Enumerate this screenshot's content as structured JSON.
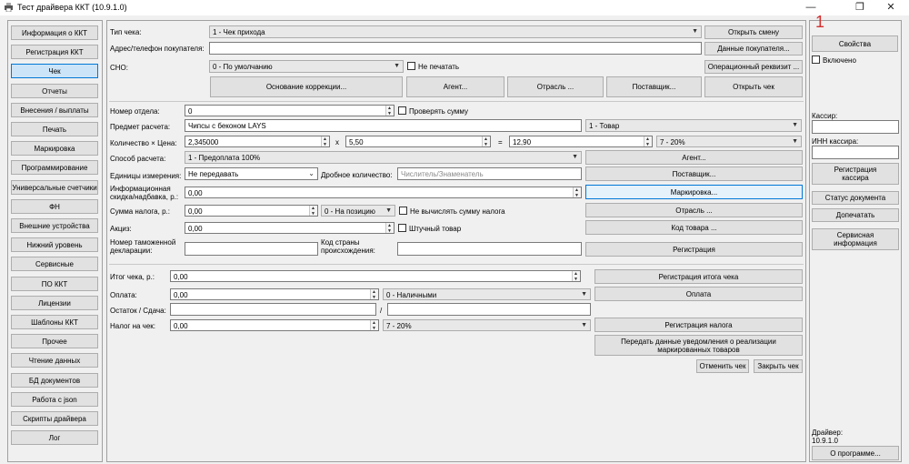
{
  "window": {
    "title": "Тест драйвера ККТ (10.9.1.0)",
    "minimize": "—",
    "maximize": "❐",
    "close": "✕"
  },
  "nav": {
    "items": [
      "Информация о ККТ",
      "Регистрация ККТ",
      "Чек",
      "Отчеты",
      "Внесения / выплаты",
      "Печать",
      "Маркировка",
      "Программирование",
      "Универсальные счетчики",
      "ФН",
      "Внешние устройства",
      "Нижний уровень",
      "Сервисные",
      "ПО ККТ",
      "Лицензии",
      "Шаблоны ККТ",
      "Прочее",
      "Чтение данных",
      "БД документов",
      "Работа с json",
      "Скрипты драйвера",
      "Лог"
    ],
    "active_index": 2
  },
  "receipt": {
    "type_label": "Тип чека:",
    "type_value": "1 - Чек прихода",
    "open_shift": "Открыть смену",
    "buyer_address_label": "Адрес/телефон покупателя:",
    "buyer_data_button": "Данные покупателя...",
    "sno_label": "СНО:",
    "sno_value": "0 - По умолчанию",
    "no_print_label": "Не печатать",
    "op_requisite_button": "Операционный реквизит ...",
    "correction_basis_button": "Основание коррекции...",
    "agent_button": "Агент...",
    "industry_button": "Отрасль ...",
    "supplier_button": "Поставщик...",
    "open_receipt_button": "Открыть чек"
  },
  "position": {
    "dept_label": "Номер отдела:",
    "dept_value": "0",
    "check_sum_label": "Проверять сумму",
    "subject_label": "Предмет расчета:",
    "subject_value": "Чипсы с беконом LAYS",
    "subject_type": "1 - Товар",
    "qty_price_label": "Количество × Цена:",
    "qty_value": "2,345000",
    "times": "x",
    "price_value": "5,50",
    "equals": "=",
    "sum_value": "12,90",
    "tax_value": "7 - 20%",
    "method_label": "Способ расчета:",
    "method_value": "1 - Предоплата 100%",
    "agent_button": "Агент...",
    "units_label": "Единицы измерения:",
    "units_value": "Не передавать",
    "fraction_label": "Дробное количество:",
    "fraction_placeholder": "Числитель/Знаменатель",
    "supplier_button": "Поставщик...",
    "markup_label": "Информационная скидка/надбавка, р.:",
    "markup_value": "0,00",
    "marking_button": "Маркировка...",
    "tax_sum_label": "Сумма налога, р.:",
    "tax_sum_value": "0,00",
    "tax_mode_value": "0 - На позицию",
    "no_calc_tax_label": "Не вычислять сумму налога",
    "industry_button": "Отрасль ...",
    "excise_label": "Акциз:",
    "excise_value": "0,00",
    "piece_label": "Штучный товар",
    "product_code_button": "Код товара ...",
    "customs_label": "Номер таможенной декларации:",
    "country_label": "Код страны происхождения:",
    "register_button": "Регистрация"
  },
  "totals": {
    "total_label": "Итог чека, р.:",
    "total_value": "0,00",
    "total_button": "Регистрация итога чека",
    "payment_label": "Оплата:",
    "payment_value": "0,00",
    "payment_type": "0 - Наличными",
    "payment_button": "Оплата",
    "change_label": "Остаток / Сдача:",
    "change_sep": "/",
    "tax_label": "Налог на чек:",
    "tax_value": "0,00",
    "tax_type": "7 - 20%",
    "tax_button": "Регистрация налога",
    "notify_button": "Передать данные уведомления о реализации маркированных товаров",
    "cancel_button": "Отменить чек",
    "close_button": "Закрыть чек"
  },
  "right": {
    "marker": "1",
    "properties_button": "Свойства",
    "enabled_label": "Включено",
    "cashier_label": "Кассир:",
    "cashier_inn_label": "ИНН кассира:",
    "register_cashier_button": "Регистрация кассира",
    "doc_status_button": "Статус документа",
    "reprint_button": "Допечатать",
    "service_info_button": "Сервисная информация",
    "driver_label": "Драйвер:",
    "driver_version": "10.9.1.0",
    "about_button": "О программе..."
  }
}
